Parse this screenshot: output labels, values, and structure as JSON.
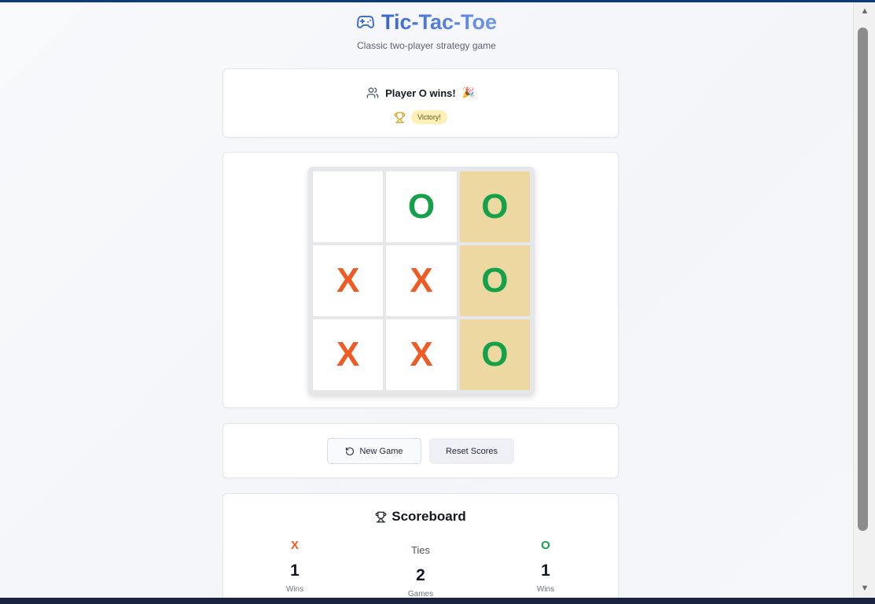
{
  "header": {
    "title": "Tic-Tac-Toe",
    "subtitle": "Classic two-player strategy game",
    "icon": "gamepad-icon"
  },
  "status": {
    "text": "Player O wins!",
    "emoji": "🎉",
    "badge": "Victory!",
    "icons": [
      "users-icon",
      "trophy-icon"
    ]
  },
  "board": {
    "cells": [
      "",
      "O",
      "O",
      "X",
      "X",
      "O",
      "X",
      "X",
      "O"
    ],
    "winning_cells": [
      2,
      5,
      8
    ]
  },
  "controls": {
    "new_game_label": "New Game",
    "reset_scores_label": "Reset Scores",
    "new_game_icon": "rotate-ccw-icon"
  },
  "scoreboard": {
    "title": "Scoreboard",
    "x": {
      "label": "X",
      "value": "1",
      "sub": "Wins"
    },
    "ties": {
      "label": "Ties",
      "value": "2",
      "sub": "Games"
    },
    "o": {
      "label": "O",
      "value": "1",
      "sub": "Wins"
    }
  },
  "colors": {
    "x": "#f05a24",
    "o": "#15a04a",
    "winning_cell": "#edd8a2",
    "title": "#3f6fd1"
  }
}
